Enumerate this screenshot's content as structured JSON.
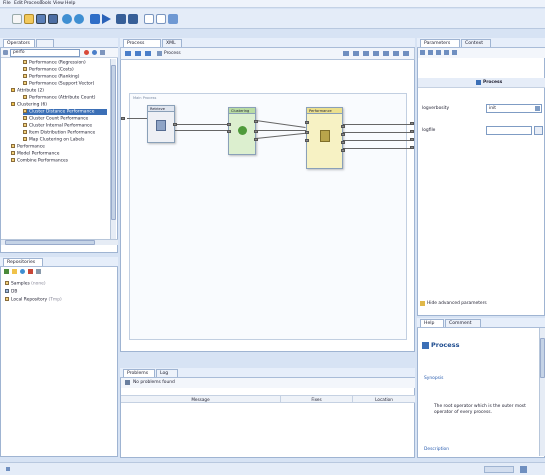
{
  "menu": [
    "File",
    "Edit",
    "Process",
    "Tools",
    "View",
    "Help"
  ],
  "toolbar": [
    "new-icon",
    "open-icon",
    "save-icon",
    "save-as-icon",
    "undo-icon",
    "redo-icon",
    "run-icon",
    "play-icon",
    "stop-icon",
    "pause-icon",
    "perspective-icon",
    "log-icon",
    "help-icon"
  ],
  "operators_panel": {
    "tab_label": "Operators",
    "tab2_label": "",
    "search_value": "perfo",
    "tree": [
      {
        "label": "Performance (Regression)"
      },
      {
        "label": "Performance (Costs)"
      },
      {
        "label": "Performance (Ranking)"
      },
      {
        "label": "Performance (Support Vector)"
      },
      {
        "label": "Attribute (2)"
      },
      {
        "label": "Performance (Attribute Count)"
      },
      {
        "label": "Clustering (6)"
      },
      {
        "label": "Cluster Distance Performance"
      },
      {
        "label": "Cluster Count Performance"
      },
      {
        "label": "Cluster Internal Performance"
      },
      {
        "label": "Item Distribution Performance"
      },
      {
        "label": "Map Clustering on Labels"
      },
      {
        "label": "Performance"
      },
      {
        "label": "Model Performance"
      },
      {
        "label": "Combine Performances"
      }
    ]
  },
  "repositories_panel": {
    "tab_label": "Repositories",
    "tree": [
      {
        "label": "Samples",
        "note": "(none)"
      },
      {
        "label": "DB"
      },
      {
        "label": "Local Repository",
        "note": "(Tmp)"
      }
    ]
  },
  "process_panel": {
    "tab_label": "Process",
    "tab2_label": "XML",
    "breadcrumb": "Process",
    "canvas_label": "Main Process",
    "operators": [
      {
        "title": "Retrieve"
      },
      {
        "title": "Clustering"
      },
      {
        "title": "Performance"
      }
    ]
  },
  "problems_panel": {
    "tab_label": "Problems",
    "tab2_label": "Log",
    "status": "No problems found",
    "columns": [
      "Message",
      "Fixes",
      "Location"
    ]
  },
  "parameters_panel": {
    "tab_label": "Parameters",
    "tab2_label": "Context",
    "section_title": "Process",
    "rows": [
      {
        "label": "logverbosity",
        "value": "init"
      },
      {
        "label": "logfile",
        "value": ""
      }
    ],
    "expert_label": "Hide advanced parameters"
  },
  "help_panel": {
    "tab_label": "Help",
    "tab2_label": "Comment",
    "title": "Process",
    "synopsis_heading": "Synopsis",
    "synopsis_text": "The root operator which is the outer most operator of every process.",
    "description_heading": "Description"
  }
}
